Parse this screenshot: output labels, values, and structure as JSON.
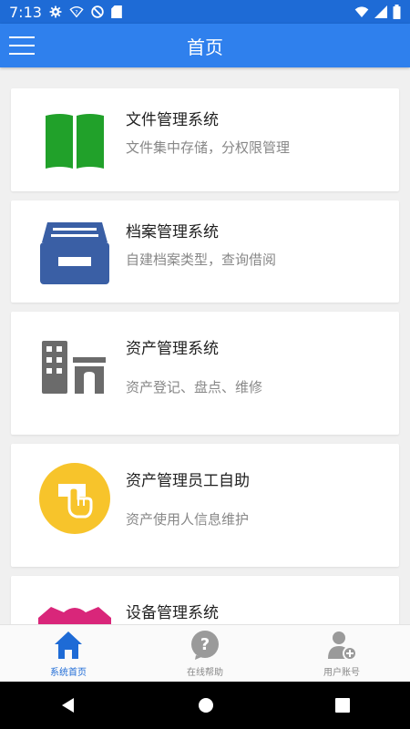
{
  "status_bar": {
    "time": "7:13",
    "icons_left": [
      "gear-icon",
      "wifi-question-icon",
      "no-disturb-icon",
      "sd-card-icon"
    ],
    "icons_right": [
      "wifi-icon",
      "signal-icon",
      "battery-icon"
    ]
  },
  "app_bar": {
    "title": "首页",
    "menu_icon": "hamburger-menu-icon",
    "color": "#2f80ed"
  },
  "cards": [
    {
      "title": "文件管理系统",
      "desc": "文件集中存储，分权限管理",
      "icon": "book-icon",
      "icon_color": "#21a12a"
    },
    {
      "title": "档案管理系统",
      "desc": "自建档案类型，查询借阅",
      "icon": "archive-box-icon",
      "icon_color": "#3a5fa5"
    },
    {
      "title": "资产管理系统",
      "desc": "资产登记、盘点、维修",
      "icon": "building-icon",
      "icon_color": "#6b6b6b"
    },
    {
      "title": "资产管理员工自助",
      "desc": "资产使用人信息维护",
      "icon": "hand-tap-icon",
      "icon_color": "#f7c42b"
    },
    {
      "title": "设备管理系统",
      "desc": "",
      "icon": "device-icon",
      "icon_color": "#d9267a"
    }
  ],
  "bottom_nav": [
    {
      "label": "系统首页",
      "icon": "home-icon",
      "active": true
    },
    {
      "label": "在线帮助",
      "icon": "help-icon",
      "active": false
    },
    {
      "label": "用户账号",
      "icon": "user-add-icon",
      "active": false
    }
  ],
  "system_nav": [
    "back-icon",
    "home-circle-icon",
    "recents-icon"
  ]
}
